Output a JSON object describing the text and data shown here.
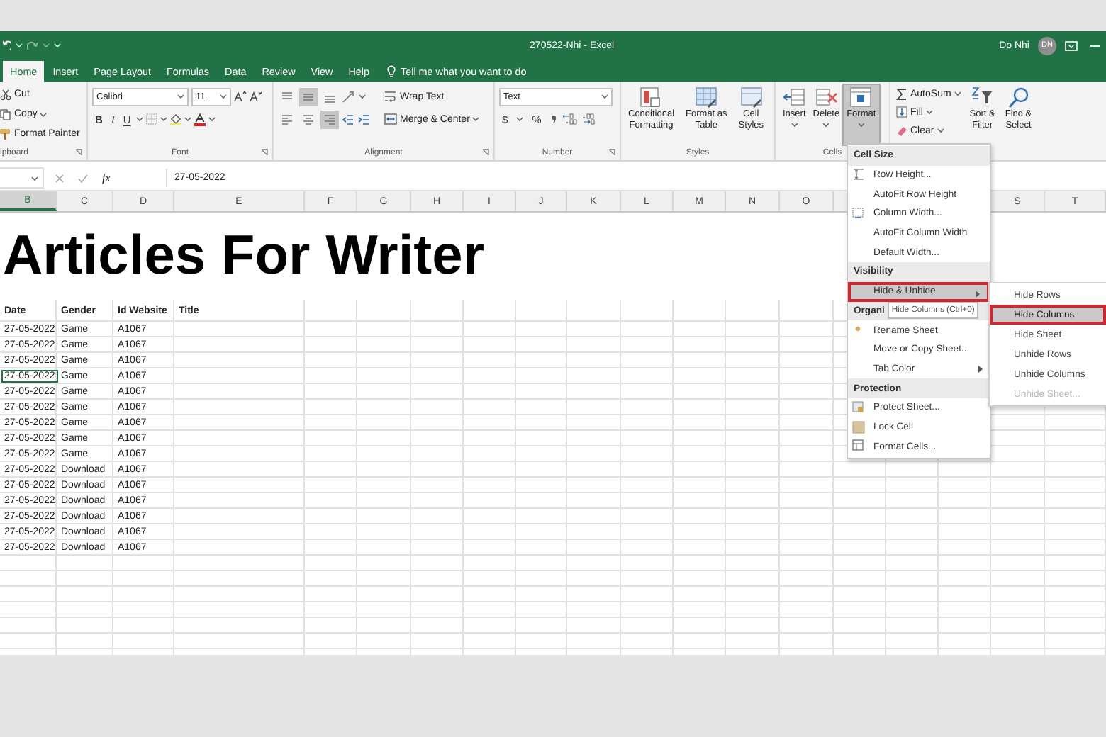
{
  "window": {
    "title": "270522-Nhi  -  Excel",
    "user": "Do Nhi",
    "avatar": "DN"
  },
  "tabs": [
    {
      "label": "Home",
      "selected": true
    },
    {
      "label": "Insert",
      "selected": false
    },
    {
      "label": "Page Layout",
      "selected": false
    },
    {
      "label": "Formulas",
      "selected": false
    },
    {
      "label": "Data",
      "selected": false
    },
    {
      "label": "Review",
      "selected": false
    },
    {
      "label": "View",
      "selected": false
    },
    {
      "label": "Help",
      "selected": false
    }
  ],
  "tell_me": {
    "placeholder": "Tell me what you want to do"
  },
  "ribbon": {
    "clipboard": {
      "label": "ipboard",
      "items": [
        {
          "kind": "cut",
          "label": "Cut"
        },
        {
          "kind": "copy",
          "label": "Copy"
        },
        {
          "kind": "painter",
          "label": "Format Painter"
        }
      ]
    },
    "font": {
      "label": "Font",
      "font_name": "Calibri",
      "font_size": "11",
      "styles": [
        "B",
        "I",
        "U"
      ]
    },
    "alignment": {
      "label": "Alignment",
      "buttons": [
        {
          "kind": "top",
          "selected": false
        },
        {
          "kind": "middle",
          "selected": true
        },
        {
          "kind": "bottom",
          "selected": false
        },
        {
          "kind": "left",
          "selected": false
        },
        {
          "kind": "center",
          "selected": false
        },
        {
          "kind": "right",
          "selected": true
        }
      ],
      "wrap_text": "Wrap Text",
      "merge": "Merge & Center"
    },
    "number": {
      "label": "Number",
      "format": "Text",
      "currency": "$",
      "percent": "%"
    },
    "styles": {
      "label": "Styles",
      "buttons": [
        {
          "kind": "conditional",
          "label": "Conditional\nFormatting"
        },
        {
          "kind": "table",
          "label": "Format as\nTable"
        },
        {
          "kind": "cellstyles",
          "label": "Cell\nStyles"
        }
      ]
    },
    "cells": {
      "label": "Cells",
      "buttons": [
        {
          "kind": "insert",
          "label": "Insert",
          "pressed": false
        },
        {
          "kind": "delete",
          "label": "Delete",
          "pressed": false
        },
        {
          "kind": "format",
          "label": "Format",
          "pressed": true
        }
      ]
    },
    "editing": {
      "small": [
        {
          "kind": "autosum",
          "label": "AutoSum"
        },
        {
          "kind": "fill",
          "label": "Fill"
        },
        {
          "kind": "clear",
          "label": "Clear"
        }
      ],
      "large": [
        {
          "kind": "sort",
          "label": "Sort &\nFilter"
        },
        {
          "kind": "find",
          "label": "Find &\nSelect"
        }
      ]
    }
  },
  "formula_bar": {
    "fx": "fx",
    "value": "27-05-2022"
  },
  "columns": [
    {
      "label": "B",
      "selected": true
    },
    {
      "label": "C",
      "selected": false
    },
    {
      "label": "D",
      "selected": false
    },
    {
      "label": "E",
      "selected": false
    },
    {
      "label": "F",
      "selected": false
    },
    {
      "label": "G",
      "selected": false
    },
    {
      "label": "H",
      "selected": false
    },
    {
      "label": "I",
      "selected": false
    },
    {
      "label": "J",
      "selected": false
    },
    {
      "label": "K",
      "selected": false
    },
    {
      "label": "L",
      "selected": false
    },
    {
      "label": "M",
      "selected": false
    },
    {
      "label": "N",
      "selected": false
    },
    {
      "label": "O",
      "selected": false
    },
    {
      "label": "S",
      "selected": false
    },
    {
      "label": "T",
      "selected": false
    }
  ],
  "sheet": {
    "title": "Articles For Writer",
    "headers": [
      "Date",
      "Gender",
      "Id Website",
      "Title"
    ],
    "rows": [
      {
        "date": "27-05-2022",
        "gender": "Game",
        "id_website": "A1067",
        "active": false
      },
      {
        "date": "27-05-2022",
        "gender": "Game",
        "id_website": "A1067",
        "active": false
      },
      {
        "date": "27-05-2022",
        "gender": "Game",
        "id_website": "A1067",
        "active": false
      },
      {
        "date": "27-05-2022",
        "gender": "Game",
        "id_website": "A1067",
        "active": true
      },
      {
        "date": "27-05-2022",
        "gender": "Game",
        "id_website": "A1067",
        "active": false
      },
      {
        "date": "27-05-2022",
        "gender": "Game",
        "id_website": "A1067",
        "active": false
      },
      {
        "date": "27-05-2022",
        "gender": "Game",
        "id_website": "A1067",
        "active": false
      },
      {
        "date": "27-05-2022",
        "gender": "Game",
        "id_website": "A1067",
        "active": false
      },
      {
        "date": "27-05-2022",
        "gender": "Game",
        "id_website": "A1067",
        "active": false
      },
      {
        "date": "27-05-2022",
        "gender": "Download",
        "id_website": "A1067",
        "active": false
      },
      {
        "date": "27-05-2022",
        "gender": "Download",
        "id_website": "A1067",
        "active": false
      },
      {
        "date": "27-05-2022",
        "gender": "Download",
        "id_website": "A1067",
        "active": false
      },
      {
        "date": "27-05-2022",
        "gender": "Download",
        "id_website": "A1067",
        "active": false
      },
      {
        "date": "27-05-2022",
        "gender": "Download",
        "id_website": "A1067",
        "active": false
      },
      {
        "date": "27-05-2022",
        "gender": "Download",
        "id_website": "A1067",
        "active": false
      }
    ]
  },
  "format_menu": {
    "items": [
      {
        "kind": "header",
        "label": "Cell Size"
      },
      {
        "kind": "rowsize",
        "label": "Row Height..."
      },
      {
        "kind": "item",
        "label": "AutoFit Row Height"
      },
      {
        "kind": "colsize",
        "label": "Column Width..."
      },
      {
        "kind": "item",
        "label": "AutoFit Column Width"
      },
      {
        "kind": "item",
        "label": "Default Width..."
      },
      {
        "kind": "header",
        "label": "Visibility"
      },
      {
        "kind": "submenu",
        "label": "Hide & Unhide",
        "highlighted": true
      },
      {
        "kind": "header",
        "label": "Organi",
        "tooltip": "Hide Columns (Ctrl+0)"
      },
      {
        "kind": "rename",
        "label": "Rename Sheet"
      },
      {
        "kind": "item",
        "label": "Move or Copy Sheet..."
      },
      {
        "kind": "submenu",
        "label": "Tab Color",
        "highlighted": false
      },
      {
        "kind": "header",
        "label": "Protection"
      },
      {
        "kind": "protect",
        "label": "Protect Sheet..."
      },
      {
        "kind": "lock",
        "label": "Lock Cell"
      },
      {
        "kind": "cells",
        "label": "Format Cells..."
      }
    ]
  },
  "submenu": {
    "items": [
      {
        "label": "Hide Rows",
        "highlighted": false,
        "disabled": false
      },
      {
        "label": "Hide Columns",
        "highlighted": true,
        "disabled": false
      },
      {
        "label": "Hide Sheet",
        "highlighted": false,
        "disabled": false
      },
      {
        "label": "Unhide Rows",
        "highlighted": false,
        "disabled": false
      },
      {
        "label": "Unhide Columns",
        "highlighted": false,
        "disabled": false
      },
      {
        "label": "Unhide Sheet...",
        "highlighted": false,
        "disabled": true
      }
    ]
  }
}
